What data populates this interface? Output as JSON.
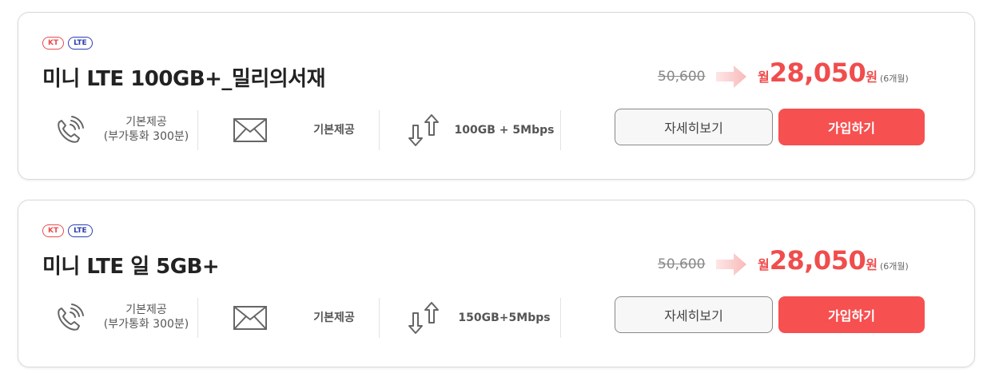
{
  "plans": [
    {
      "badges": [
        "KT",
        "LTE"
      ],
      "title": "미니 LTE 100GB+_밀리의서재",
      "voice": [
        "기본제공",
        "(부가통화 300분)"
      ],
      "sms": "기본제공",
      "data": "100GB + 5Mbps",
      "original_price": "50,600",
      "price_prefix": "월",
      "price": "28,050",
      "price_suffix": "원",
      "price_period": "(6개월)",
      "detail_label": "자세히보기",
      "join_label": "가입하기"
    },
    {
      "badges": [
        "KT",
        "LTE"
      ],
      "title": "미니 LTE 일 5GB+",
      "voice": [
        "기본제공",
        "(부가통화 300분)"
      ],
      "sms": "기본제공",
      "data": "150GB+5Mbps",
      "original_price": "50,600",
      "price_prefix": "월",
      "price": "28,050",
      "price_suffix": "원",
      "price_period": "(6개월)",
      "detail_label": "자세히보기",
      "join_label": "가입하기"
    }
  ],
  "icons": {
    "voice": "phone-ringing-icon",
    "sms": "envelope-icon",
    "data": "up-down-arrows-icon",
    "price_arrow": "right-arrow-icon"
  },
  "colors": {
    "accent": "#f65050",
    "kt_badge": "#e84d4d",
    "lte_badge": "#2a3fb0"
  }
}
